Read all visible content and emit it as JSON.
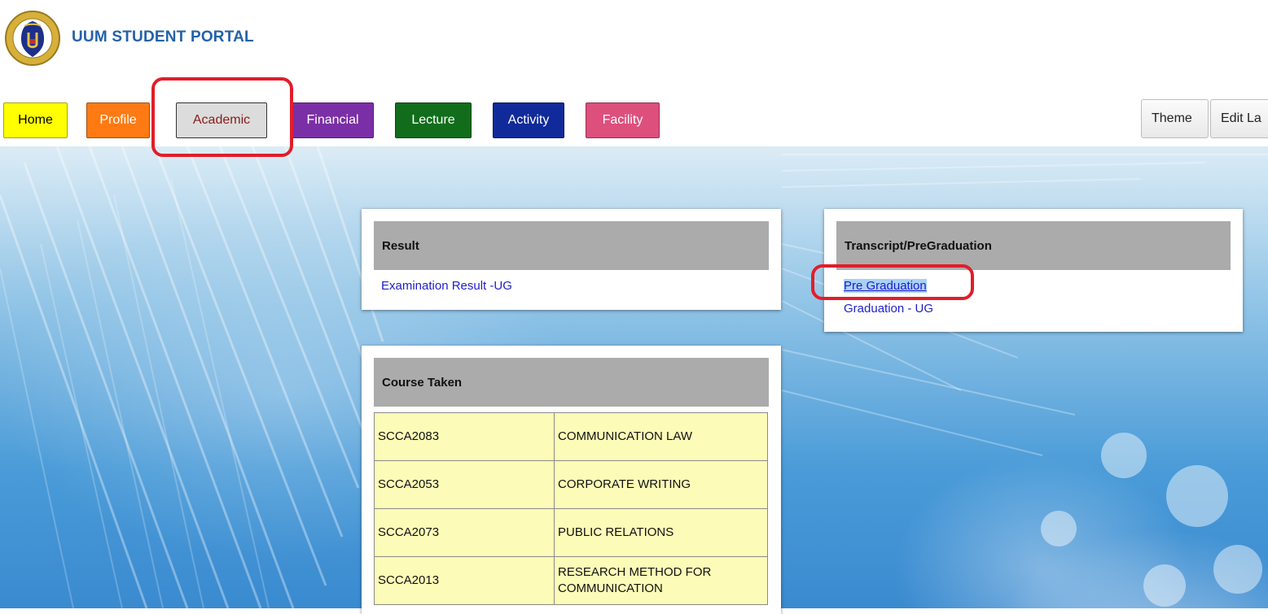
{
  "header": {
    "title": "UUM STUDENT PORTAL",
    "logo_icon": "university-crest-icon"
  },
  "nav": {
    "items": [
      {
        "label": "Home",
        "bg": "#ffff00",
        "color": "#000000"
      },
      {
        "label": "Profile",
        "bg": "#ff7a13",
        "color": "#ffffff"
      },
      {
        "label": "Academic",
        "bg": "#dcdcdc",
        "color": "#8b1a1a",
        "active": true
      },
      {
        "label": "Financial",
        "bg": "#7b2fa6",
        "color": "#ffffff"
      },
      {
        "label": "Lecture",
        "bg": "#116d1b",
        "color": "#ffffff"
      },
      {
        "label": "Activity",
        "bg": "#102a9a",
        "color": "#ffffff"
      },
      {
        "label": "Facility",
        "bg": "#dd4f7c",
        "color": "#ffffff"
      }
    ],
    "right": {
      "theme_label": "Theme",
      "edit_label": "Edit La"
    }
  },
  "result": {
    "title": "Result",
    "links": [
      "Examination Result -UG"
    ]
  },
  "transcript": {
    "title": "Transcript/PreGraduation",
    "links": [
      "Pre Graduation",
      "Graduation - UG"
    ]
  },
  "courses": {
    "title": "Course Taken",
    "rows": [
      {
        "code": "SCCA2083",
        "name": "COMMUNICATION LAW"
      },
      {
        "code": "SCCA2053",
        "name": "CORPORATE WRITING"
      },
      {
        "code": "SCCA2073",
        "name": "PUBLIC RELATIONS"
      },
      {
        "code": "SCCA2013",
        "name": "RESEARCH METHOD FOR COMMUNICATION"
      }
    ]
  },
  "colors": {
    "brand": "#2461a8",
    "link": "#1e1ecc",
    "panel_header": "#ababab",
    "table_bg": "#fcfbb8",
    "highlight": "#e21d2a"
  }
}
